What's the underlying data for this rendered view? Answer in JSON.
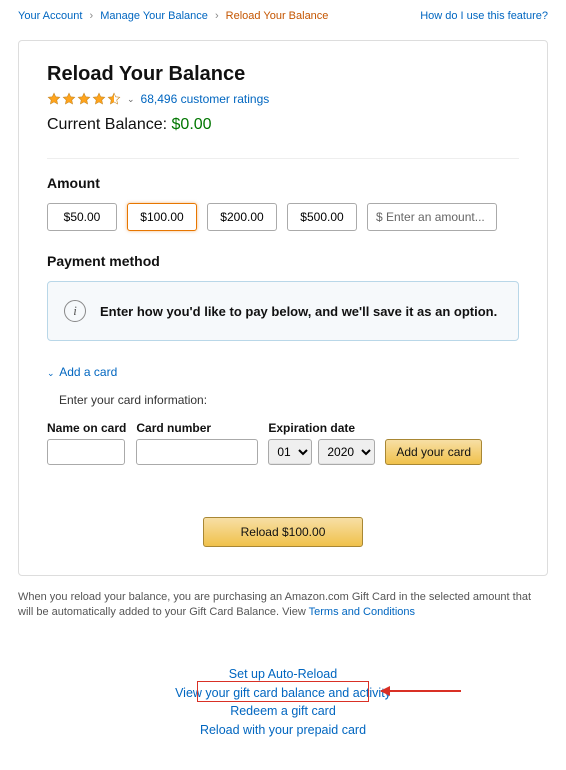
{
  "breadcrumb": {
    "account": "Your Account",
    "manage": "Manage Your Balance",
    "current": "Reload Your Balance",
    "help": "How do I use this feature?"
  },
  "title": "Reload Your Balance",
  "ratings": {
    "count_text": "68,496 customer ratings"
  },
  "balance": {
    "label": "Current Balance:",
    "amount": "$0.00"
  },
  "amount": {
    "heading": "Amount",
    "options": [
      "$50.00",
      "$100.00",
      "$200.00",
      "$500.00"
    ],
    "placeholder": "$ Enter an amount..."
  },
  "payment": {
    "heading": "Payment method",
    "prompt": "Enter how you'd like to pay below, and we'll save it as an option."
  },
  "add_card": {
    "link": "Add a card",
    "instructions": "Enter your card information:",
    "name_label": "Name on card",
    "number_label": "Card number",
    "exp_label": "Expiration date",
    "month": "01",
    "year": "2020",
    "button": "Add your card"
  },
  "reload_button": "Reload $100.00",
  "footer": {
    "text": "When you reload your balance, you are purchasing an Amazon.com Gift Card in the selected amount that will be automatically added to your Gift Card Balance. View ",
    "terms": "Terms and Conditions"
  },
  "bottom_links": {
    "auto": "Set up Auto-Reload",
    "view": "View your gift card balance and activity",
    "redeem": "Redeem a gift card",
    "prepaid": "Reload with your prepaid card"
  }
}
